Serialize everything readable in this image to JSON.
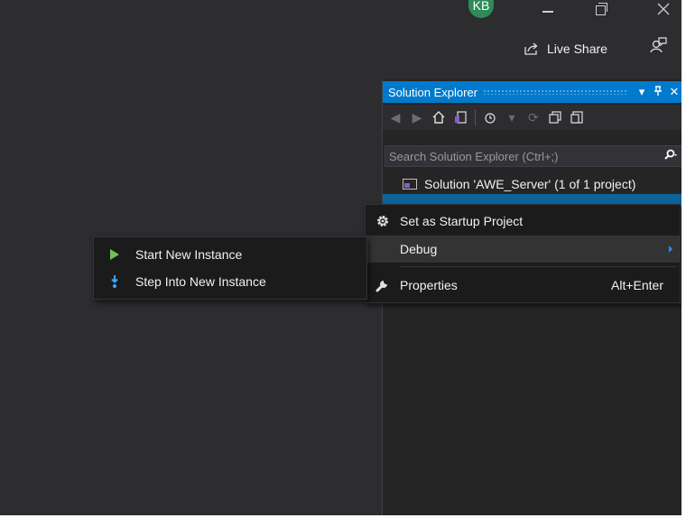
{
  "titlebar": {
    "avatar_initials": "KB",
    "live_share_label": "Live Share"
  },
  "solution_explorer": {
    "title": "Solution Explorer",
    "search_placeholder": "Search Solution Explorer (Ctrl+;)",
    "solution_label": "Solution 'AWE_Server' (1 of 1 project)"
  },
  "context_menu": {
    "items": [
      {
        "label": "Set as Startup Project",
        "icon": "gear-icon",
        "shortcut": ""
      },
      {
        "label": "Debug",
        "icon": "",
        "shortcut": ""
      },
      {
        "label": "Properties",
        "icon": "wrench-icon",
        "shortcut": "Alt+Enter"
      }
    ]
  },
  "debug_submenu": {
    "items": [
      {
        "label": "Start New Instance",
        "icon": "play-icon"
      },
      {
        "label": "Step Into New Instance",
        "icon": "step-into-icon"
      }
    ]
  },
  "colors": {
    "accent": "#007acc",
    "background": "#2d2d30",
    "menu_background": "#1b1b1c",
    "play_green": "#71c254",
    "step_blue": "#3ea8ff"
  }
}
